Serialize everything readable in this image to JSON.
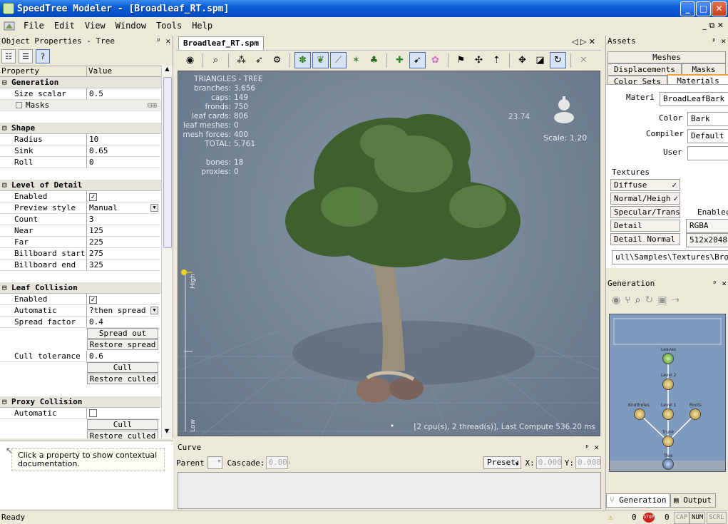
{
  "window": {
    "title": "SpeedTree Modeler - [Broadleaf_RT.spm]",
    "min": "_",
    "max": "□",
    "close": "✕"
  },
  "menu": [
    "File",
    "Edit",
    "View",
    "Window",
    "Tools",
    "Help"
  ],
  "left": {
    "title": "Object Properties - Tree",
    "ctrls": "ᵖ ✕",
    "col_property": "Property",
    "col_value": "Value",
    "groups": {
      "generation": "Generation",
      "shape": "Shape",
      "lod": "Level of Detail",
      "leaf_collision": "Leaf Collision",
      "proxy_collision": "Proxy Collision"
    },
    "rows": {
      "size_scalar": [
        "Size scalar",
        "0.5"
      ],
      "masks": "Masks",
      "radius": [
        "Radius",
        "10"
      ],
      "sink": [
        "Sink",
        "0.65"
      ],
      "roll": [
        "Roll",
        "0"
      ],
      "lod_enabled": [
        "Enabled",
        "✓"
      ],
      "preview_style": [
        "Preview style",
        "Manual"
      ],
      "count": [
        "Count",
        "3"
      ],
      "near": [
        "Near",
        "125"
      ],
      "far": [
        "Far",
        "225"
      ],
      "billboard_start": [
        "Billboard start",
        "275"
      ],
      "billboard_end": [
        "Billboard end",
        "325"
      ],
      "lc_enabled": [
        "Enabled",
        "✓"
      ],
      "automatic": [
        "Automatic",
        "?then spread"
      ],
      "spread_factor": [
        "Spread factor",
        "0.4"
      ],
      "cull_tolerance": [
        "Cull tolerance",
        "0.6"
      ],
      "proxy_automatic": [
        "Automatic",
        ""
      ]
    },
    "buttons": {
      "spread_out": "Spread out",
      "restore_spread": "Restore spread",
      "cull": "Cull",
      "restore_culled": "Restore culled",
      "cull2": "Cull",
      "restore_culled2": "Restore culled"
    },
    "help": "Click a property to show contextual documentation."
  },
  "viewer": {
    "tab": "Broadleaf_RT.spm",
    "stats_title": "TRIANGLES - TREE",
    "stats": [
      [
        "branches:",
        "3,656"
      ],
      [
        "caps:",
        "149"
      ],
      [
        "fronds:",
        "750"
      ],
      [
        "leaf cards:",
        "806"
      ],
      [
        "leaf meshes:",
        "0"
      ],
      [
        "mesh forces:",
        "400"
      ],
      [
        "TOTAL:",
        "5,761"
      ]
    ],
    "bones": [
      "bones:",
      "18"
    ],
    "proxies": [
      "proxies:",
      "0"
    ],
    "height_readout": "23.74",
    "scale": "Scale: 1.20",
    "lod_high": "High",
    "lod_low": "Low",
    "compute_info": "[2 cpu(s), 2 thread(s)], Last Compute 536.20 ms"
  },
  "curve": {
    "title": "Curve",
    "parent_label": "Parent",
    "cascade_label": "Cascade:",
    "cascade_value": "0.00",
    "preset_label": "Preset:",
    "x_label": "X:",
    "x_value": "0.000",
    "y_label": "Y:",
    "y_value": "0.000"
  },
  "assets": {
    "title": "Assets",
    "tabs": [
      "Meshes",
      "Displacements",
      "Masks",
      "Color Sets",
      "Materials"
    ],
    "material_label": "Materi",
    "material_value": "BroadLeafBark",
    "color_label": "Color",
    "color_value": "Bark",
    "compiler_label": "Compiler",
    "compiler_value": "Default",
    "user_label": "User",
    "user_value": "",
    "textures_label": "Textures",
    "textures": [
      "Diffuse",
      "Normal/Heigh",
      "Specular/Trans.",
      "Detail",
      "Detail Normal"
    ],
    "check": "✓",
    "enabled_label": "Enablec",
    "format_value": "RGBA",
    "size_value": "512x2048",
    "path_value": "ull\\Samples\\Textures\\Broad"
  },
  "generation": {
    "title": "Generation",
    "nodes": [
      "Leaves",
      "Level 2",
      "Knotholes",
      "Level 1",
      "Roots",
      "Trunk",
      "Tree"
    ],
    "tabs": [
      "Generation",
      "Output"
    ]
  },
  "status": {
    "text": "Ready",
    "warn_count": "0",
    "stop_count": "0",
    "cap": "CAP",
    "num": "NUM",
    "scrl": "SCRL"
  },
  "colors": {
    "titlebar": "#0a5fd6",
    "viewport_bg": "#75849a",
    "graph_bg": "#7e9bbd"
  }
}
